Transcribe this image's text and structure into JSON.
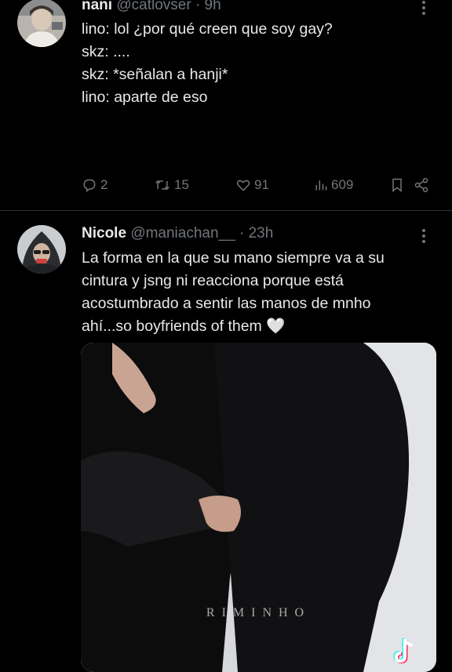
{
  "tweets": [
    {
      "author_name": "nani",
      "handle_time": "@catlovser · 9h",
      "lines": [
        "lino: lol ¿por qué creen que soy gay?",
        "",
        "skz: ....",
        "",
        "skz: *señalan a hanji*",
        "",
        "lino: aparte de eso"
      ],
      "actions": {
        "replies": "2",
        "retweets": "15",
        "likes": "91",
        "views": "609"
      }
    },
    {
      "author_name": "Nicole",
      "handle_time": "@maniachan__ · 23h",
      "lines": [
        "La forma en la que su mano siempre va a su",
        "cintura y jsng ni reacciona porque está",
        "acostumbrado a sentir las manos de mnho",
        "ahí...so boyfriends of them 🤍"
      ],
      "media": {
        "watermark": "RIMINHO",
        "logo": "tiktok-icon"
      }
    }
  ],
  "icons": {
    "reply": "reply-icon",
    "retweet": "retweet-icon",
    "like": "heart-icon",
    "views": "views-chart-icon",
    "bookmark": "bookmark-icon",
    "share": "share-icon",
    "more": "more-icon"
  },
  "colors": {
    "background": "#000000",
    "text": "#e7e9ea",
    "secondary": "#71767b",
    "divider": "#2f3336"
  }
}
